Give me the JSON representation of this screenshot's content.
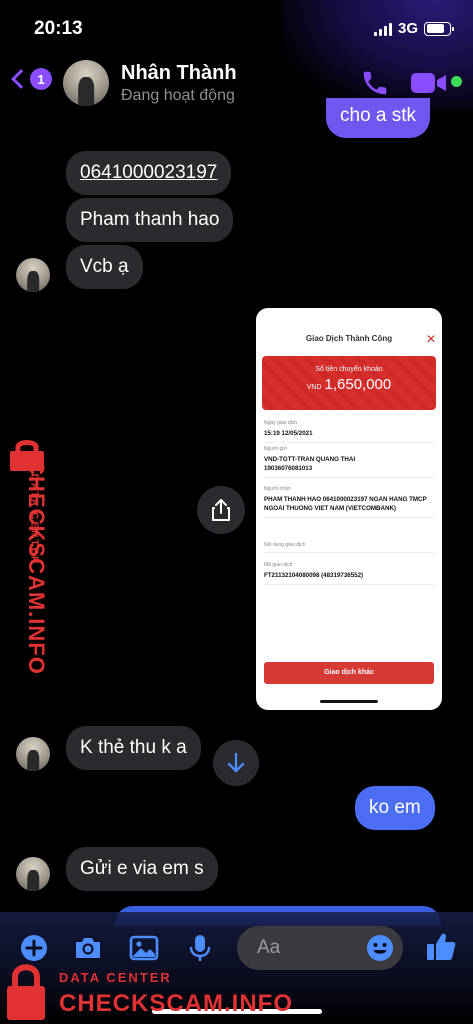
{
  "status_bar": {
    "time": "20:13",
    "network": "3G",
    "battery_level": 0.8
  },
  "header": {
    "back_badge": "1",
    "contact_name": "Nhân Thành",
    "contact_status": "Đang hoạt động",
    "accent_color": "#8a4dff"
  },
  "messages": {
    "out_clipped": "cho a stk",
    "account_number": "0641000023197",
    "account_name": "Pham thanh hao",
    "bank": "Vcb ạ",
    "no_card": "K thẻ thu k a",
    "reply_ko_em": "ko em",
    "gui_e_via": "Gửi e via em s"
  },
  "receipt": {
    "title": "Giao Dịch Thành Công",
    "amount_label": "Số tiền chuyển khoản",
    "currency": "VND",
    "amount": "1,650,000",
    "fields": [
      {
        "label": "Ngày giao dịch",
        "value": "15:19 12/05/2021"
      },
      {
        "label": "Người gửi",
        "value": "VND-TGTT-TRAN QUANG THAI 19036076081013"
      },
      {
        "label": "Người nhận",
        "value": "PHAM THANH HAO 0641000023197 NGAN HANG TMCP NGOAI THUONG VIET NAM (VIETCOMBANK)"
      },
      {
        "label": "Nội dung giao dịch",
        "value": ""
      },
      {
        "label": "Mã giao dịch",
        "value": "FT21132104080098 (48319736552)"
      }
    ],
    "button_label": "Giao dịch khác"
  },
  "composer": {
    "placeholder": "Aa"
  },
  "watermark": {
    "small": "DATA CENTER",
    "big": "CHECKSCAM.INFO"
  },
  "colors": {
    "outgoing": "#4c6ef5",
    "incoming": "#2b2b2f",
    "accent": "#8a4dff",
    "receipt_red": "#d7302c"
  }
}
